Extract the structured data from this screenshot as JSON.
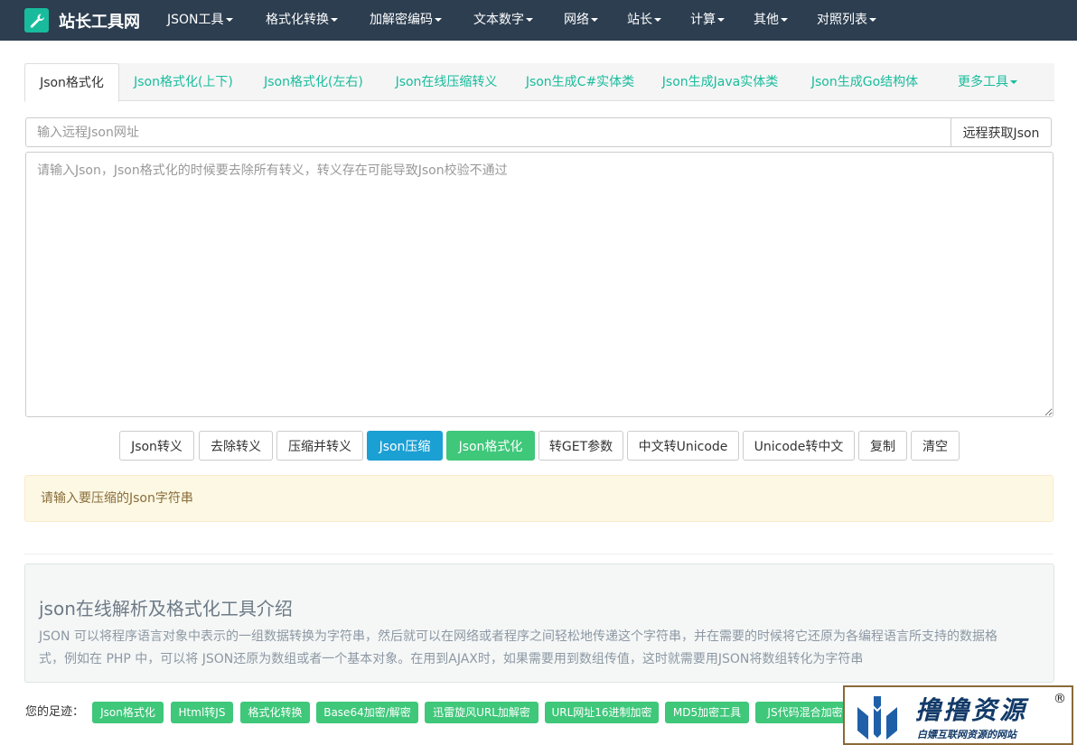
{
  "navbar": {
    "brand": "站长工具网",
    "logo_icon": "wrench-icon",
    "items": [
      "JSON工具",
      "格式化转换",
      "加解密编码",
      "文本数字",
      "网络",
      "站长",
      "计算",
      "其他",
      "对照列表"
    ]
  },
  "tabs": [
    "Json格式化",
    "Json格式化(上下)",
    "Json格式化(左右)",
    "Json在线压缩转义",
    "Json生成C#实体类",
    "Json生成Java实体类",
    "Json生成Go结构体",
    "更多工具"
  ],
  "remote": {
    "placeholder": "输入远程Json网址",
    "button": "远程获取Json"
  },
  "editor": {
    "placeholder": "请输入Json，Json格式化的时候要去除所有转义，转义存在可能导致Json校验不通过"
  },
  "actions": [
    "Json转义",
    "去除转义",
    "压缩并转义",
    "Json压缩",
    "Json格式化",
    "转GET参数",
    "中文转Unicode",
    "Unicode转中文",
    "复制",
    "清空"
  ],
  "alert": "请输入要压缩的Json字符串",
  "intro": {
    "title": "json在线解析及格式化工具介绍",
    "body": "JSON 可以将程序语言对象中表示的一组数据转换为字符串，然后就可以在网络或者程序之间轻松地传递这个字符串，并在需要的时候将它还原为各编程语言所支持的数据格式，例如在 PHP 中，可以将 JSON还原为数组或者一个基本对象。在用到AJAX时，如果需要用到数组传值，这时就需要用JSON将数组转化为字符串"
  },
  "footprints": {
    "label": "您的足迹：",
    "items": [
      "Json格式化",
      "Html转JS",
      "格式化转换",
      "Base64加密/解密",
      "迅雷旋风URL加解密",
      "URL网址16进制加密",
      "MD5加密工具",
      "JS代码混合加密"
    ]
  },
  "watermark": {
    "main": "撸撸资源",
    "reg": "®",
    "sub": "白嫖互联网资源的网站"
  },
  "colors": {
    "navbar": "#2c3e50",
    "brand_green": "#18bc9c",
    "primary": "#1ba0d4",
    "success": "#3fc77a"
  }
}
